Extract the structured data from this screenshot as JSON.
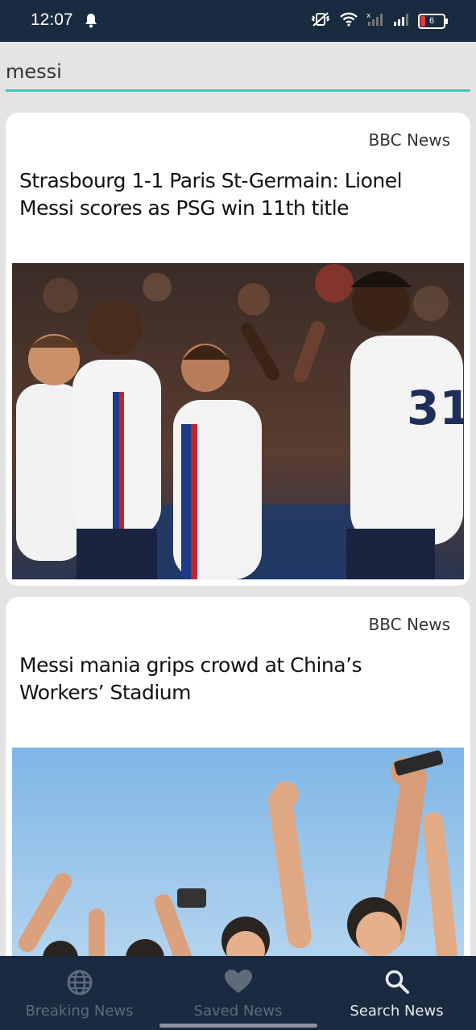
{
  "status_bar": {
    "time": "12:07",
    "battery_level": "6"
  },
  "search": {
    "query": "messi"
  },
  "articles": [
    {
      "source": "BBC News",
      "title": "Strasbourg 1-1 Paris St-Germain: Lionel Messi scores as PSG win 11th title",
      "image_kind": "football-players-celebrating-photo"
    },
    {
      "source": "BBC News",
      "title": "Messi mania grips crowd at China’s Workers’ Stadium",
      "image_kind": "crowd-cheering-photo"
    }
  ],
  "bottom_nav": {
    "items": [
      {
        "label": "Breaking News",
        "icon": "globe-icon",
        "active": false
      },
      {
        "label": "Saved News",
        "icon": "heart-icon",
        "active": false
      },
      {
        "label": "Search News",
        "icon": "search-icon",
        "active": true
      }
    ]
  },
  "colors": {
    "status_bar_bg": "#1a2a40",
    "accent": "#3ec8b4",
    "nav_bg": "#1a2a40",
    "nav_inactive": "#5f6b7a",
    "nav_active": "#e8eaee"
  }
}
